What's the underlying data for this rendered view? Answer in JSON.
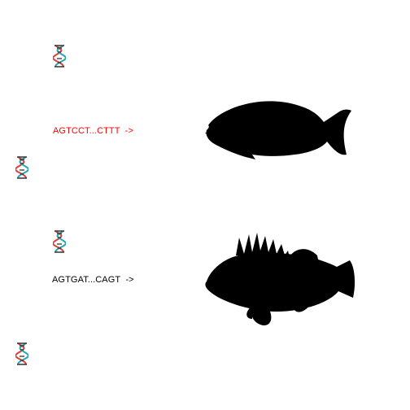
{
  "sequences": [
    {
      "text": "AGTCCT...CTTT  ->",
      "color": "#ff0000"
    },
    {
      "text": "AGTGAT...CAGT  ->",
      "color": "#000000"
    }
  ],
  "icons": {
    "dna": "dna-helix-icon",
    "fish_1": "surgeonfish-silhouette",
    "fish_2": "rockfish-silhouette"
  },
  "colors": {
    "helix_red": "#e0403a",
    "helix_teal": "#2aa6b0",
    "helix_dark": "#333333",
    "silhouette": "#000000"
  }
}
